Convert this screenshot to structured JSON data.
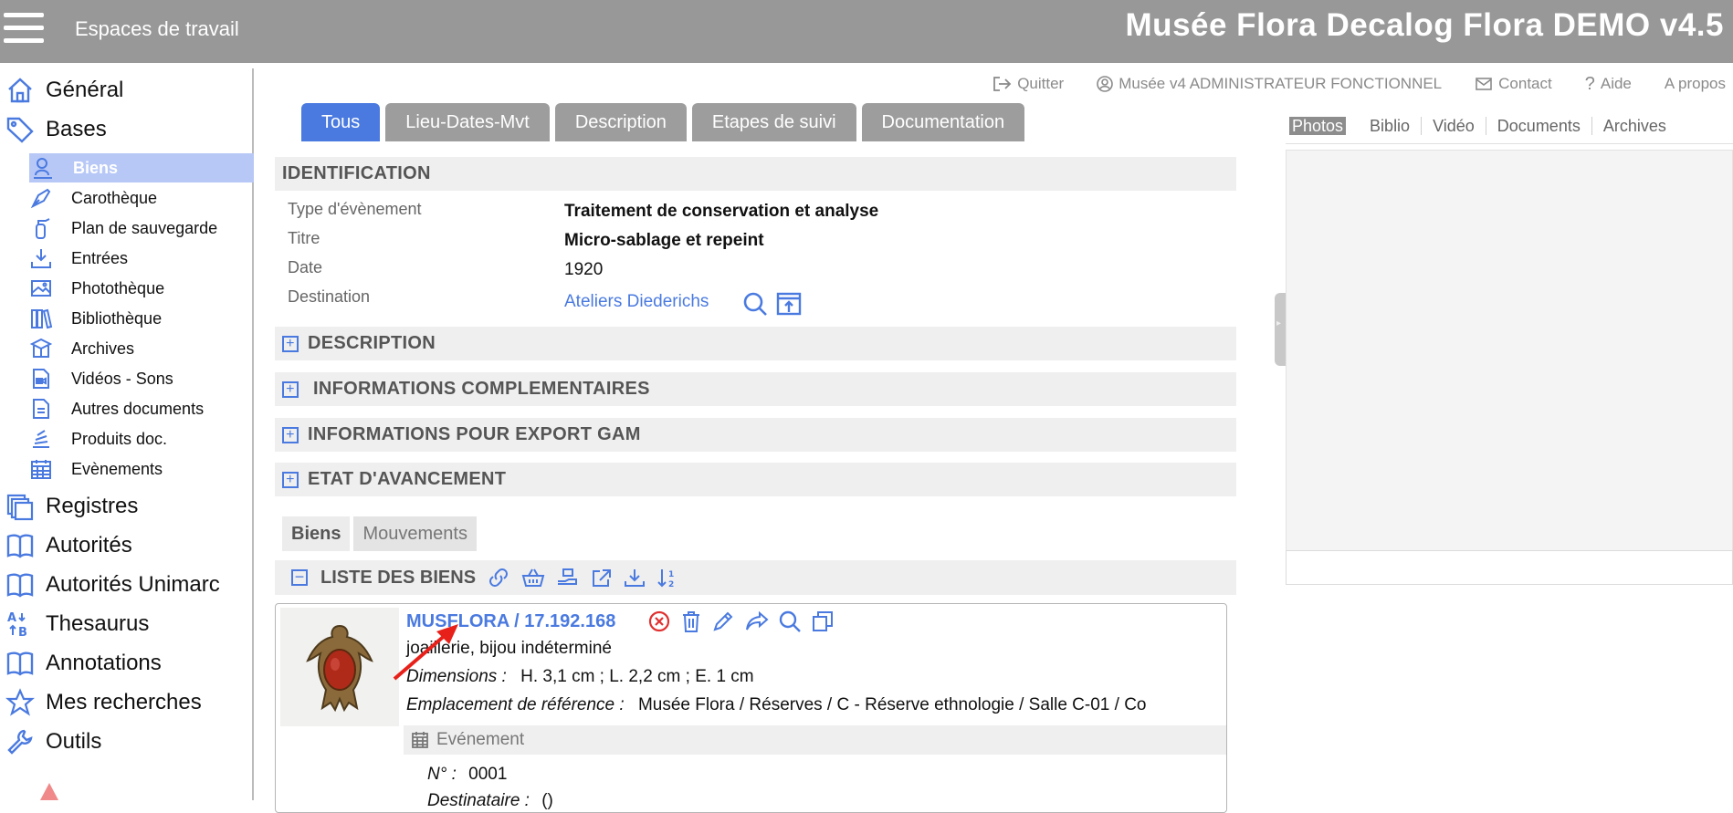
{
  "header": {
    "workspaces_label": "Espaces de travail",
    "app_title": "Musée Flora Decalog Flora DEMO v4.5"
  },
  "top_links": {
    "quit": "Quitter",
    "user": "Musée v4 ADMINISTRATEUR FONCTIONNEL",
    "contact": "Contact",
    "help": "Aide",
    "about": "A propos"
  },
  "sidebar": {
    "general": "Général",
    "bases": "Bases",
    "sub_items": [
      {
        "label": "Biens",
        "icon": "bust-icon"
      },
      {
        "label": "Carothèque",
        "icon": "pen-nib-icon"
      },
      {
        "label": "Plan de sauvegarde",
        "icon": "extinguisher-icon"
      },
      {
        "label": "Entrées",
        "icon": "download-tray-icon"
      },
      {
        "label": "Photothèque",
        "icon": "images-icon"
      },
      {
        "label": "Bibliothèque",
        "icon": "books-icon"
      },
      {
        "label": "Archives",
        "icon": "archive-box-icon"
      },
      {
        "label": "Vidéos - Sons",
        "icon": "video-file-icon"
      },
      {
        "label": "Autres documents",
        "icon": "document-icon"
      },
      {
        "label": "Produits doc.",
        "icon": "stack-icon"
      },
      {
        "label": "Evènements",
        "icon": "calendar-icon"
      }
    ],
    "registres": "Registres",
    "autorites": "Autorités",
    "autorites_unimarc": "Autorités Unimarc",
    "thesaurus": "Thesaurus",
    "annotations": "Annotations",
    "mes_recherches": "Mes recherches",
    "outils": "Outils"
  },
  "tabs": [
    "Tous",
    "Lieu-Dates-Mvt",
    "Description",
    "Etapes de suivi",
    "Documentation"
  ],
  "identification": {
    "title": "IDENTIFICATION",
    "type_label": "Type d'évènement",
    "type_value": "Traitement de conservation et analyse",
    "titre_label": "Titre",
    "titre_value": "Micro-sablage et repeint",
    "date_label": "Date",
    "date_value": "1920",
    "destination_label": "Destination",
    "destination_value": "Ateliers Diederichs"
  },
  "sections": {
    "description": "DESCRIPTION",
    "infos_comp": "INFORMATIONS COMPLEMENTAIRES",
    "export_gam": "INFORMATIONS POUR EXPORT GAM",
    "etat": "ETAT D'AVANCEMENT"
  },
  "subtabs": [
    "Biens",
    "Mouvements"
  ],
  "liste": {
    "title": "LISTE DES BIENS"
  },
  "item": {
    "inventory": "MUSFLORA / 17.192.168",
    "designation": "joaillerie, bijou indéterminé",
    "dimensions_label": "Dimensions  :",
    "dimensions_value": "H. 3,1 cm ; L. 2,2 cm ; E. 1 cm",
    "emplacement_label": "Emplacement de référence :",
    "emplacement_value": "Musée Flora / Réserves / C - Réserve ethnologie / Salle C-01 / Co",
    "event_label": "Evénement",
    "numero_label": "N° :",
    "numero_value": "0001",
    "destinataire_label": "Destinataire :",
    "destinataire_value": "()"
  },
  "media_tabs": [
    "Photos",
    "Biblio",
    "Vidéo",
    "Documents",
    "Archives"
  ],
  "colors": {
    "accent": "#4a7ae0",
    "header_bg": "#989898",
    "active_sidebar": "#b7c8f7",
    "delete_red": "#e03030"
  }
}
